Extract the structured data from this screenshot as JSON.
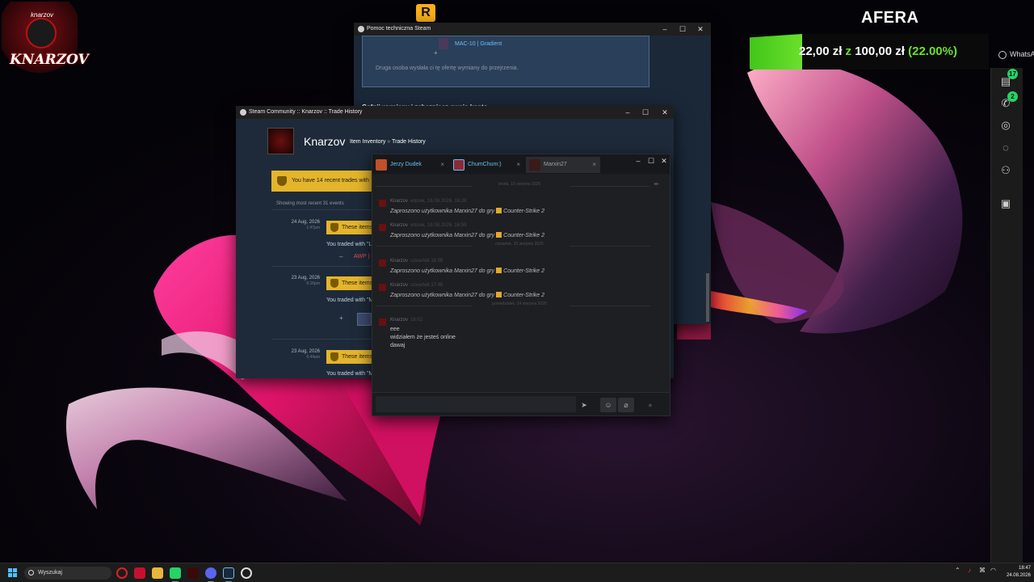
{
  "overlay": {
    "logo_small_text": "knarzov",
    "logo_text": "KNARZOV",
    "rockstar_icon": "R",
    "goal_title": "AFERA",
    "goal_current": "22,00 zł",
    "goal_sep": "z",
    "goal_target": "100,00 zł",
    "goal_percent_text": "(22.00%)",
    "goal_progress": 0.22,
    "accent_color": "#6be02b"
  },
  "whatsapp": {
    "label": "WhatsA",
    "chats_badge": "17",
    "calls_badge": "2"
  },
  "support_window": {
    "title": "Pomoc techniczna Steam",
    "plus": "+",
    "item_link": "MAC-10 | Gradient",
    "note": "Druga osoba wysłała ci tę ofertę wymiany do przejrzenia.",
    "heading": "Cofnij wymiany i zabezpiecz swoje konto"
  },
  "trade_window": {
    "title": "Steam Community :: Knarzov :: Trade History",
    "profile_name": "Knarzov",
    "crumb_inventory": "Item Inventory",
    "crumb_sep": "»",
    "crumb_history": "Trade History",
    "notice": "You have 14 recent trades with",
    "recent_label": "Showing most recent 31 events",
    "trades": [
      {
        "date": "24 Aug, 2026",
        "time": "1:47pm",
        "badge": "These items",
        "with": "You traded with \"L",
        "item": "AWP | ("
      },
      {
        "date": "23 Aug, 2026",
        "time": "5:16pm",
        "badge": "These items",
        "with": "You traded with \"M",
        "item": ""
      },
      {
        "date": "23 Aug, 2026",
        "time": "6:44am",
        "badge": "These items",
        "with": "You traded with \"M",
        "item": ""
      }
    ]
  },
  "chat_window": {
    "tabs": [
      {
        "name": "Jerzy Dudek",
        "close": "×"
      },
      {
        "name": "ChumChum:)",
        "close": "×"
      },
      {
        "name": "Marxin27",
        "close": "×"
      }
    ],
    "day_separators": [
      "środa, 19 sierpnia 2026",
      "czwartek, 20 sierpnia 2026",
      "poniedziałek, 24 sierpnia 2026"
    ],
    "messages": [
      {
        "name": "Knarzov",
        "time": "wtorek, 18.08.2026, 16:28",
        "text_prefix": "Zaproszono użytkownika Marxin27 do gry",
        "game": "Counter-Strike 2"
      },
      {
        "name": "Knarzov",
        "time": "wtorek, 18.08.2026, 16:59",
        "text_prefix": "Zaproszono użytkownika Marxin27 do gry",
        "game": "Counter-Strike 2"
      },
      {
        "name": "Knarzov",
        "time": "czwartek 16:58",
        "text_prefix": "Zaproszono użytkownika Marxin27 do gry",
        "game": "Counter-Strike 2"
      },
      {
        "name": "Knarzov",
        "time": "czwartek 17:46",
        "text_prefix": "Zaproszono użytkownika Marxin27 do gry",
        "game": "Counter-Strike 2"
      }
    ],
    "last_message": {
      "name": "Knarzov",
      "time": "18:02",
      "lines": [
        "eee",
        "widziałem że jesteś online",
        "dawaj"
      ]
    }
  },
  "taskbar": {
    "search_placeholder": "Wyszukaj",
    "time": "18:47",
    "date": "24.08.2026"
  }
}
